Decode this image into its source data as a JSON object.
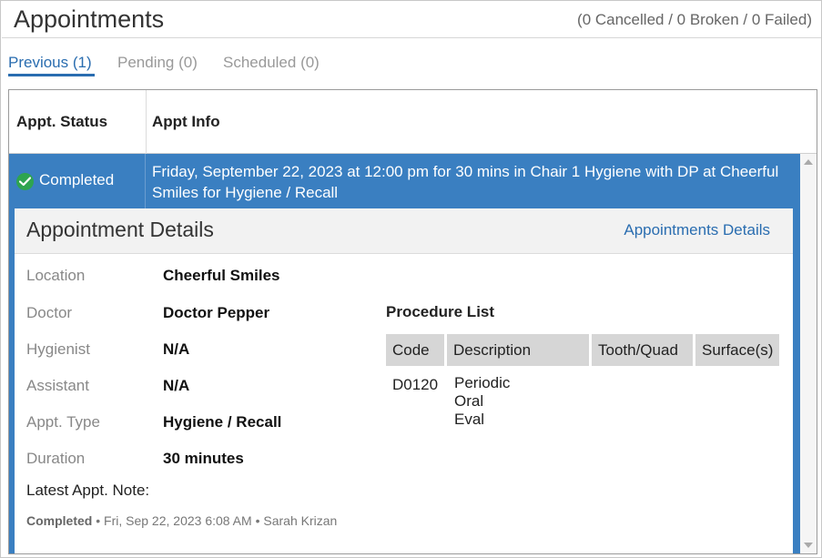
{
  "header": {
    "title": "Appointments",
    "summary": "(0 Cancelled / 0 Broken / 0 Failed)"
  },
  "tabs": [
    {
      "label": "Previous (1)",
      "active": true
    },
    {
      "label": "Pending (0)",
      "active": false
    },
    {
      "label": "Scheduled (0)",
      "active": false
    }
  ],
  "table": {
    "columns": [
      "Appt. Status",
      "Appt Info"
    ],
    "rows": [
      {
        "status": "Completed",
        "status_icon": "check-circle-icon",
        "info": "Friday, September 22, 2023 at 12:00 pm for 30 mins in Chair 1 Hygiene with DP at Cheerful Smiles for Hygiene / Recall"
      }
    ]
  },
  "details": {
    "title": "Appointment Details",
    "link": "Appointments Details",
    "fields": [
      {
        "label": "Location",
        "value": "Cheerful Smiles"
      },
      {
        "label": "Doctor",
        "value": "Doctor Pepper"
      },
      {
        "label": "Hygienist",
        "value": "N/A"
      },
      {
        "label": "Assistant",
        "value": "N/A"
      },
      {
        "label": "Appt. Type",
        "value": "Hygiene / Recall"
      },
      {
        "label": "Duration",
        "value": "30 minutes"
      }
    ],
    "note_label": "Latest Appt. Note:",
    "note": {
      "status": "Completed",
      "timestamp": "Fri, Sep 22, 2023 6:08 AM",
      "author": "Sarah Krizan",
      "separator": "•"
    },
    "procedures": {
      "title": "Procedure List",
      "columns": [
        "Code",
        "Description",
        "Tooth/Quad",
        "Surface(s)"
      ],
      "rows": [
        {
          "code": "D0120",
          "description": "Periodic Oral Eval",
          "tooth": "",
          "surface": ""
        }
      ]
    }
  },
  "colors": {
    "accent": "#2a6db0",
    "row_selected": "#3a7fc1",
    "success": "#2ea44f"
  }
}
